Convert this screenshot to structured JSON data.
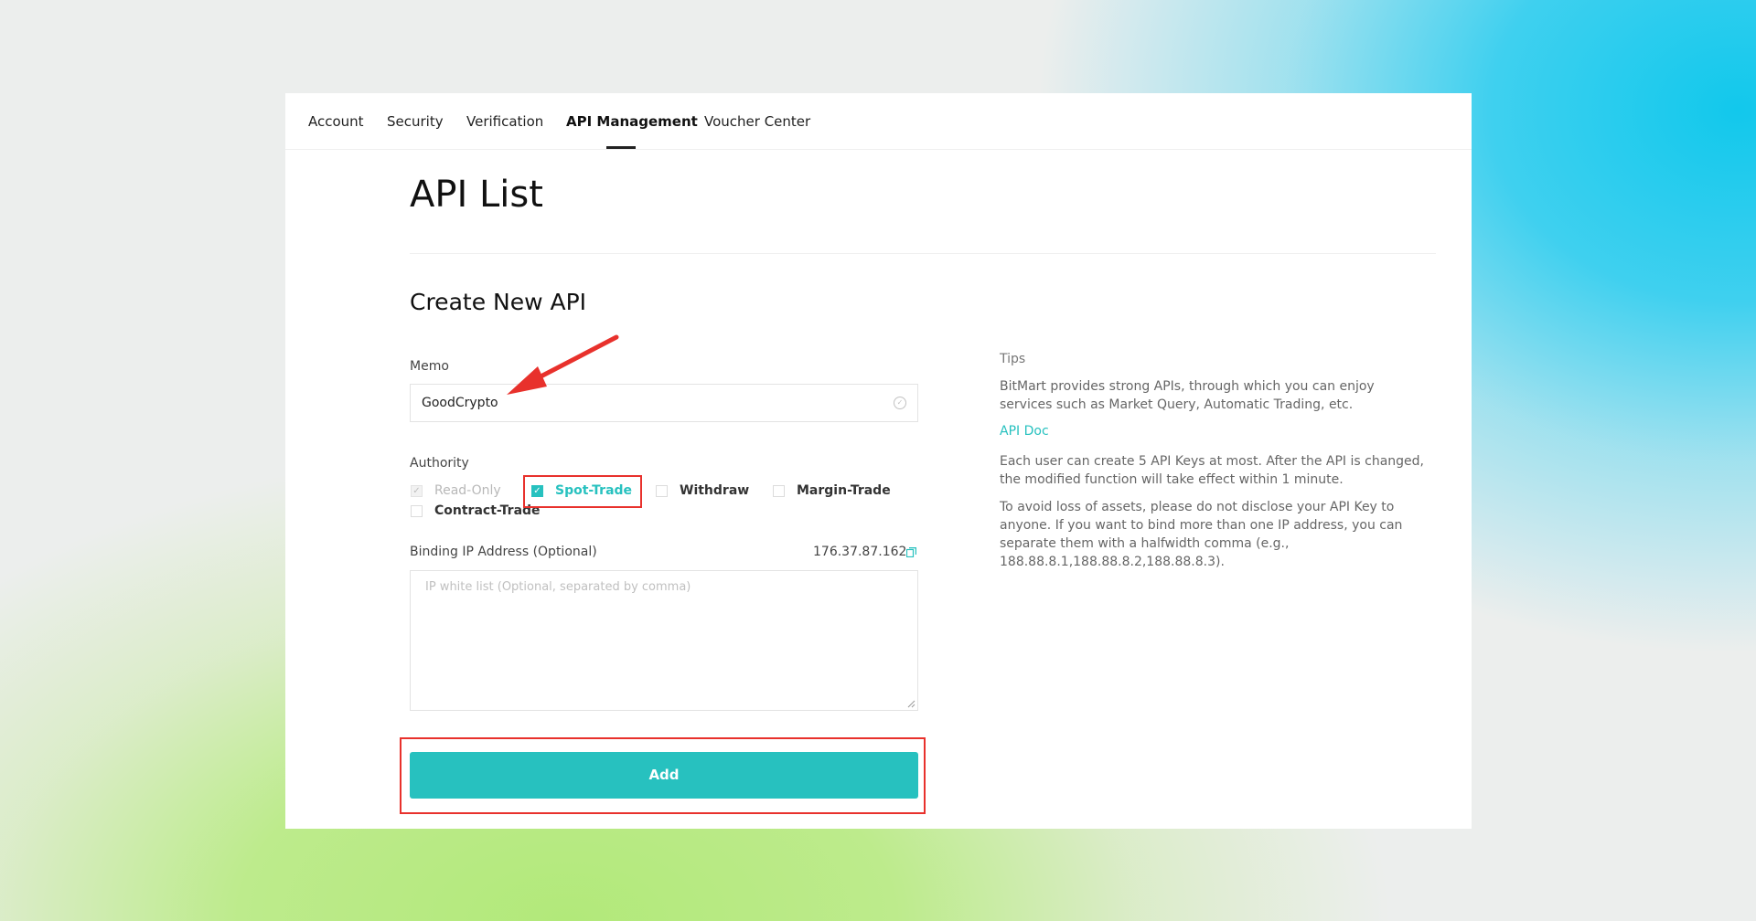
{
  "nav": {
    "items": [
      {
        "label": "Account"
      },
      {
        "label": "Security"
      },
      {
        "label": "Verification"
      },
      {
        "label": "API Management"
      },
      {
        "label": "Voucher Center"
      }
    ],
    "active_index": 3
  },
  "page": {
    "title": "API List",
    "section_title": "Create New API"
  },
  "memo": {
    "label": "Memo",
    "value": "GoodCrypto"
  },
  "authority": {
    "label": "Authority",
    "options": [
      {
        "label": "Read-Only",
        "state": "checked-disabled"
      },
      {
        "label": "Spot-Trade",
        "state": "checked"
      },
      {
        "label": "Withdraw",
        "state": "unchecked"
      },
      {
        "label": "Margin-Trade",
        "state": "unchecked"
      },
      {
        "label": "Contract-Trade",
        "state": "unchecked"
      }
    ]
  },
  "ip": {
    "label": "Binding IP Address (Optional)",
    "current_ip": "176.37.87.162",
    "placeholder": "IP white list (Optional, separated by comma)"
  },
  "add_button": {
    "label": "Add"
  },
  "tips": {
    "title": "Tips",
    "line1": "BitMart provides strong APIs, through which you can enjoy services such as Market Query, Automatic Trading, etc.",
    "api_doc": "API Doc",
    "line2": "Each user can create 5 API Keys at most. After the API is changed, the modified function will take effect within 1 minute.",
    "line3": "To avoid loss of assets, please do not disclose your API Key to anyone. If you want to bind more than one IP address, you can separate them with a halfwidth comma (e.g., 188.88.8.1,188.88.8.2,188.88.8.3)."
  },
  "colors": {
    "accent": "#27c1bf",
    "highlight": "#e8312c"
  }
}
